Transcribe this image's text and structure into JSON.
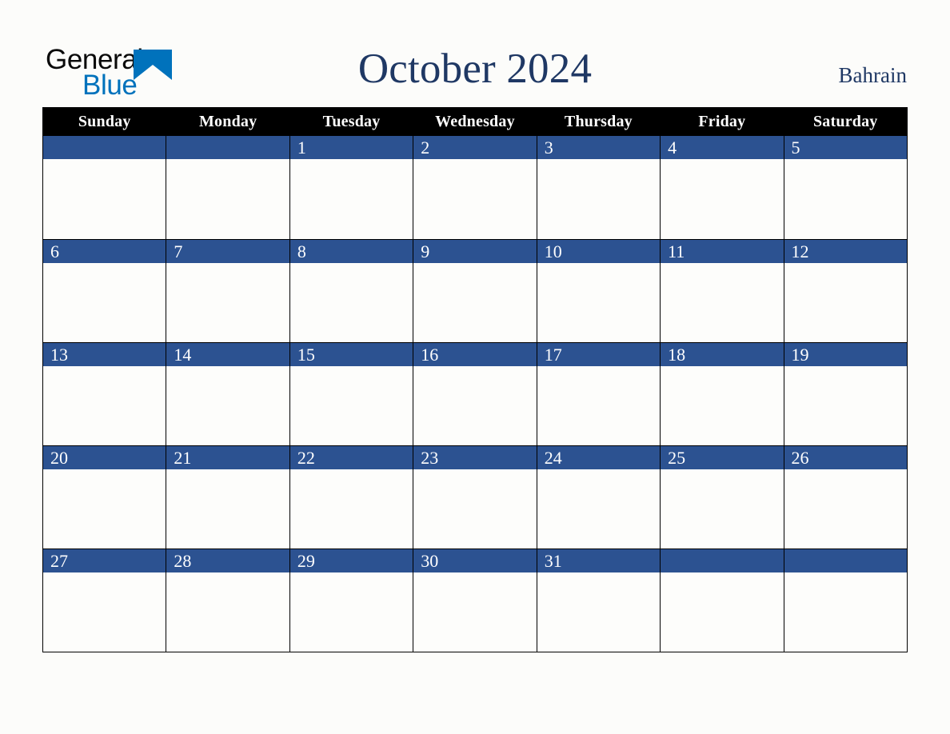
{
  "brand": {
    "name_part1": "General",
    "name_part2": "Blue",
    "triangle_color": "#0072bc",
    "text_color": "#0a0a0a"
  },
  "header": {
    "title": "October 2024",
    "region": "Bahrain",
    "title_color": "#1f3864"
  },
  "calendar": {
    "header_bg": "#000000",
    "header_fg": "#ffffff",
    "daybar_bg": "#2c5291",
    "daybar_fg": "#ffffff",
    "cell_bg": "#fdfdfb",
    "border_color": "#000000",
    "weekdays": [
      "Sunday",
      "Monday",
      "Tuesday",
      "Wednesday",
      "Thursday",
      "Friday",
      "Saturday"
    ],
    "weeks": [
      [
        {
          "day": "",
          "note": ""
        },
        {
          "day": "",
          "note": ""
        },
        {
          "day": "1",
          "note": ""
        },
        {
          "day": "2",
          "note": ""
        },
        {
          "day": "3",
          "note": ""
        },
        {
          "day": "4",
          "note": ""
        },
        {
          "day": "5",
          "note": ""
        }
      ],
      [
        {
          "day": "6",
          "note": ""
        },
        {
          "day": "7",
          "note": ""
        },
        {
          "day": "8",
          "note": ""
        },
        {
          "day": "9",
          "note": ""
        },
        {
          "day": "10",
          "note": ""
        },
        {
          "day": "11",
          "note": ""
        },
        {
          "day": "12",
          "note": ""
        }
      ],
      [
        {
          "day": "13",
          "note": ""
        },
        {
          "day": "14",
          "note": ""
        },
        {
          "day": "15",
          "note": ""
        },
        {
          "day": "16",
          "note": ""
        },
        {
          "day": "17",
          "note": ""
        },
        {
          "day": "18",
          "note": ""
        },
        {
          "day": "19",
          "note": ""
        }
      ],
      [
        {
          "day": "20",
          "note": ""
        },
        {
          "day": "21",
          "note": ""
        },
        {
          "day": "22",
          "note": ""
        },
        {
          "day": "23",
          "note": ""
        },
        {
          "day": "24",
          "note": ""
        },
        {
          "day": "25",
          "note": ""
        },
        {
          "day": "26",
          "note": ""
        }
      ],
      [
        {
          "day": "27",
          "note": ""
        },
        {
          "day": "28",
          "note": ""
        },
        {
          "day": "29",
          "note": ""
        },
        {
          "day": "30",
          "note": ""
        },
        {
          "day": "31",
          "note": ""
        },
        {
          "day": "",
          "note": ""
        },
        {
          "day": "",
          "note": ""
        }
      ]
    ]
  }
}
